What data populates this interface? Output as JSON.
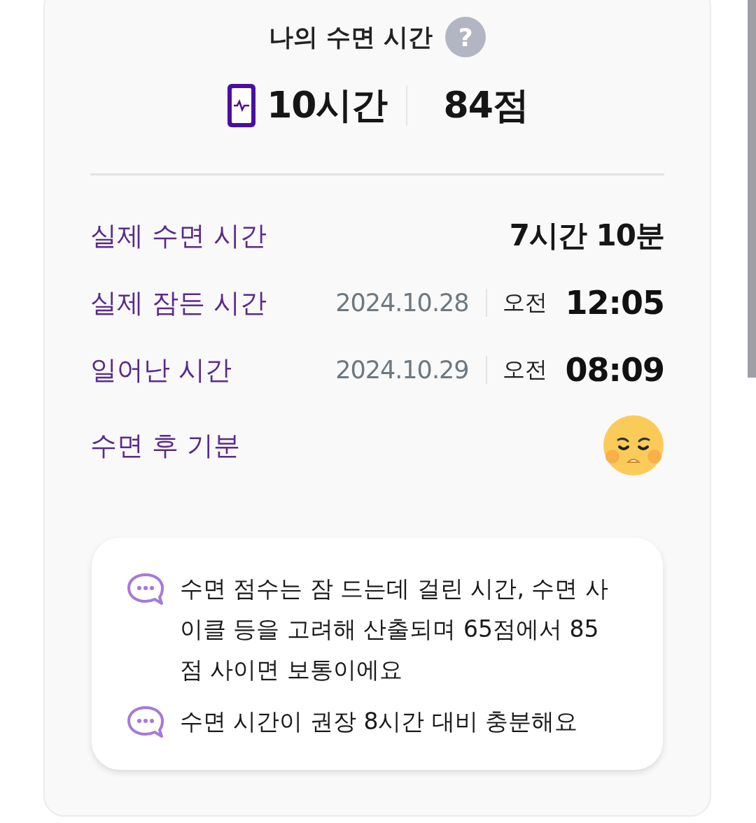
{
  "title": "나의 수면 시간",
  "help_glyph": "?",
  "summary": {
    "duration": "10시간",
    "score": "84점"
  },
  "rows": [
    {
      "kind": "duration",
      "label": "실제 수면 시간",
      "value": "7시간 10분"
    },
    {
      "kind": "time",
      "label": "실제 잠든 시간",
      "date": "2024.10.28",
      "meridiem": "오전",
      "time": "12:05"
    },
    {
      "kind": "time",
      "label": "일어난 시간",
      "date": "2024.10.29",
      "meridiem": "오전",
      "time": "08:09"
    },
    {
      "kind": "mood",
      "label": "수면 후 기분"
    }
  ],
  "notes": [
    "수면 점수는 잠 드는데 걸린 시간, 수면 사이클 등을 고려해 산출되며 65점에서 85점 사이면 보통이에요",
    "수면 시간이 권장 8시간 대비 충분해요"
  ]
}
